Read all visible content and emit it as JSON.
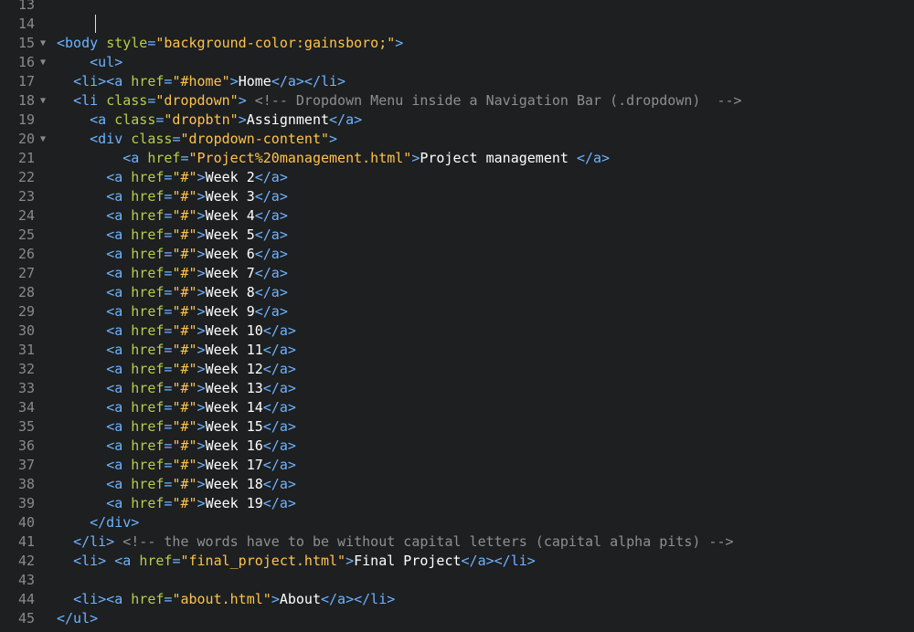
{
  "editor": {
    "lines": [
      {
        "num": "13",
        "fold": "",
        "indent": "",
        "tokens": []
      },
      {
        "num": "14",
        "fold": "",
        "indent": "",
        "tokens": []
      },
      {
        "num": "15",
        "fold": "▼",
        "indent": "",
        "tokens": [
          {
            "t": "tag",
            "v": "<body"
          },
          {
            "t": "txt",
            "v": " "
          },
          {
            "t": "attr",
            "v": "style"
          },
          {
            "t": "tag",
            "v": "="
          },
          {
            "t": "str",
            "v": "\"background-color:gainsboro;\""
          },
          {
            "t": "tag",
            "v": ">"
          }
        ]
      },
      {
        "num": "16",
        "fold": "▼",
        "indent": "    ",
        "tokens": [
          {
            "t": "tag",
            "v": "<ul>"
          }
        ]
      },
      {
        "num": "17",
        "fold": "",
        "indent": "  ",
        "tokens": [
          {
            "t": "tag",
            "v": "<li><a"
          },
          {
            "t": "txt",
            "v": " "
          },
          {
            "t": "attr",
            "v": "href"
          },
          {
            "t": "tag",
            "v": "="
          },
          {
            "t": "str",
            "v": "\"#home\""
          },
          {
            "t": "tag",
            "v": ">"
          },
          {
            "t": "txt",
            "v": "Home"
          },
          {
            "t": "tag",
            "v": "</a></li>"
          }
        ]
      },
      {
        "num": "18",
        "fold": "▼",
        "indent": "  ",
        "tokens": [
          {
            "t": "tag",
            "v": "<li"
          },
          {
            "t": "txt",
            "v": " "
          },
          {
            "t": "attr",
            "v": "class"
          },
          {
            "t": "tag",
            "v": "="
          },
          {
            "t": "str",
            "v": "\"dropdown\""
          },
          {
            "t": "tag",
            "v": ">"
          },
          {
            "t": "txt",
            "v": " "
          },
          {
            "t": "comment",
            "v": "<!-- Dropdown Menu inside a Navigation Bar (.dropdown)  -->"
          }
        ]
      },
      {
        "num": "19",
        "fold": "",
        "indent": "    ",
        "tokens": [
          {
            "t": "tag",
            "v": "<a"
          },
          {
            "t": "txt",
            "v": " "
          },
          {
            "t": "attr",
            "v": "class"
          },
          {
            "t": "tag",
            "v": "="
          },
          {
            "t": "str",
            "v": "\"dropbtn\""
          },
          {
            "t": "tag",
            "v": ">"
          },
          {
            "t": "txt",
            "v": "Assignment"
          },
          {
            "t": "tag",
            "v": "</a>"
          }
        ]
      },
      {
        "num": "20",
        "fold": "▼",
        "indent": "    ",
        "tokens": [
          {
            "t": "tag",
            "v": "<div"
          },
          {
            "t": "txt",
            "v": " "
          },
          {
            "t": "attr",
            "v": "class"
          },
          {
            "t": "tag",
            "v": "="
          },
          {
            "t": "str",
            "v": "\"dropdown-content\""
          },
          {
            "t": "tag",
            "v": ">"
          }
        ]
      },
      {
        "num": "21",
        "fold": "",
        "indent": "        ",
        "tokens": [
          {
            "t": "tag",
            "v": "<a"
          },
          {
            "t": "txt",
            "v": " "
          },
          {
            "t": "attr",
            "v": "href"
          },
          {
            "t": "tag",
            "v": "="
          },
          {
            "t": "str",
            "v": "\"Project%20management.html\""
          },
          {
            "t": "tag",
            "v": ">"
          },
          {
            "t": "txt",
            "v": "Project management "
          },
          {
            "t": "tag",
            "v": "</a>"
          }
        ]
      },
      {
        "num": "22",
        "fold": "",
        "indent": "      ",
        "tokens": [
          {
            "t": "tag",
            "v": "<a"
          },
          {
            "t": "txt",
            "v": " "
          },
          {
            "t": "attr",
            "v": "href"
          },
          {
            "t": "tag",
            "v": "="
          },
          {
            "t": "str",
            "v": "\"#\""
          },
          {
            "t": "tag",
            "v": ">"
          },
          {
            "t": "txt",
            "v": "Week 2"
          },
          {
            "t": "tag",
            "v": "</a>"
          }
        ]
      },
      {
        "num": "23",
        "fold": "",
        "indent": "      ",
        "tokens": [
          {
            "t": "tag",
            "v": "<a"
          },
          {
            "t": "txt",
            "v": " "
          },
          {
            "t": "attr",
            "v": "href"
          },
          {
            "t": "tag",
            "v": "="
          },
          {
            "t": "str",
            "v": "\"#\""
          },
          {
            "t": "tag",
            "v": ">"
          },
          {
            "t": "txt",
            "v": "Week 3"
          },
          {
            "t": "tag",
            "v": "</a>"
          }
        ]
      },
      {
        "num": "24",
        "fold": "",
        "indent": "      ",
        "tokens": [
          {
            "t": "tag",
            "v": "<a"
          },
          {
            "t": "txt",
            "v": " "
          },
          {
            "t": "attr",
            "v": "href"
          },
          {
            "t": "tag",
            "v": "="
          },
          {
            "t": "str",
            "v": "\"#\""
          },
          {
            "t": "tag",
            "v": ">"
          },
          {
            "t": "txt",
            "v": "Week 4"
          },
          {
            "t": "tag",
            "v": "</a>"
          }
        ]
      },
      {
        "num": "25",
        "fold": "",
        "indent": "      ",
        "tokens": [
          {
            "t": "tag",
            "v": "<a"
          },
          {
            "t": "txt",
            "v": " "
          },
          {
            "t": "attr",
            "v": "href"
          },
          {
            "t": "tag",
            "v": "="
          },
          {
            "t": "str",
            "v": "\"#\""
          },
          {
            "t": "tag",
            "v": ">"
          },
          {
            "t": "txt",
            "v": "Week 5"
          },
          {
            "t": "tag",
            "v": "</a>"
          }
        ]
      },
      {
        "num": "26",
        "fold": "",
        "indent": "      ",
        "tokens": [
          {
            "t": "tag",
            "v": "<a"
          },
          {
            "t": "txt",
            "v": " "
          },
          {
            "t": "attr",
            "v": "href"
          },
          {
            "t": "tag",
            "v": "="
          },
          {
            "t": "str",
            "v": "\"#\""
          },
          {
            "t": "tag",
            "v": ">"
          },
          {
            "t": "txt",
            "v": "Week 6"
          },
          {
            "t": "tag",
            "v": "</a>"
          }
        ]
      },
      {
        "num": "27",
        "fold": "",
        "indent": "      ",
        "tokens": [
          {
            "t": "tag",
            "v": "<a"
          },
          {
            "t": "txt",
            "v": " "
          },
          {
            "t": "attr",
            "v": "href"
          },
          {
            "t": "tag",
            "v": "="
          },
          {
            "t": "str",
            "v": "\"#\""
          },
          {
            "t": "tag",
            "v": ">"
          },
          {
            "t": "txt",
            "v": "Week 7"
          },
          {
            "t": "tag",
            "v": "</a>"
          }
        ]
      },
      {
        "num": "28",
        "fold": "",
        "indent": "      ",
        "tokens": [
          {
            "t": "tag",
            "v": "<a"
          },
          {
            "t": "txt",
            "v": " "
          },
          {
            "t": "attr",
            "v": "href"
          },
          {
            "t": "tag",
            "v": "="
          },
          {
            "t": "str",
            "v": "\"#\""
          },
          {
            "t": "tag",
            "v": ">"
          },
          {
            "t": "txt",
            "v": "Week 8"
          },
          {
            "t": "tag",
            "v": "</a>"
          }
        ]
      },
      {
        "num": "29",
        "fold": "",
        "indent": "      ",
        "tokens": [
          {
            "t": "tag",
            "v": "<a"
          },
          {
            "t": "txt",
            "v": " "
          },
          {
            "t": "attr",
            "v": "href"
          },
          {
            "t": "tag",
            "v": "="
          },
          {
            "t": "str",
            "v": "\"#\""
          },
          {
            "t": "tag",
            "v": ">"
          },
          {
            "t": "txt",
            "v": "Week 9"
          },
          {
            "t": "tag",
            "v": "</a>"
          }
        ]
      },
      {
        "num": "30",
        "fold": "",
        "indent": "      ",
        "tokens": [
          {
            "t": "tag",
            "v": "<a"
          },
          {
            "t": "txt",
            "v": " "
          },
          {
            "t": "attr",
            "v": "href"
          },
          {
            "t": "tag",
            "v": "="
          },
          {
            "t": "str",
            "v": "\"#\""
          },
          {
            "t": "tag",
            "v": ">"
          },
          {
            "t": "txt",
            "v": "Week 10"
          },
          {
            "t": "tag",
            "v": "</a>"
          }
        ]
      },
      {
        "num": "31",
        "fold": "",
        "indent": "      ",
        "tokens": [
          {
            "t": "tag",
            "v": "<a"
          },
          {
            "t": "txt",
            "v": " "
          },
          {
            "t": "attr",
            "v": "href"
          },
          {
            "t": "tag",
            "v": "="
          },
          {
            "t": "str",
            "v": "\"#\""
          },
          {
            "t": "tag",
            "v": ">"
          },
          {
            "t": "txt",
            "v": "Week 11"
          },
          {
            "t": "tag",
            "v": "</a>"
          }
        ]
      },
      {
        "num": "32",
        "fold": "",
        "indent": "      ",
        "tokens": [
          {
            "t": "tag",
            "v": "<a"
          },
          {
            "t": "txt",
            "v": " "
          },
          {
            "t": "attr",
            "v": "href"
          },
          {
            "t": "tag",
            "v": "="
          },
          {
            "t": "str",
            "v": "\"#\""
          },
          {
            "t": "tag",
            "v": ">"
          },
          {
            "t": "txt",
            "v": "Week 12"
          },
          {
            "t": "tag",
            "v": "</a>"
          }
        ]
      },
      {
        "num": "33",
        "fold": "",
        "indent": "      ",
        "tokens": [
          {
            "t": "tag",
            "v": "<a"
          },
          {
            "t": "txt",
            "v": " "
          },
          {
            "t": "attr",
            "v": "href"
          },
          {
            "t": "tag",
            "v": "="
          },
          {
            "t": "str",
            "v": "\"#\""
          },
          {
            "t": "tag",
            "v": ">"
          },
          {
            "t": "txt",
            "v": "Week 13"
          },
          {
            "t": "tag",
            "v": "</a>"
          }
        ]
      },
      {
        "num": "34",
        "fold": "",
        "indent": "      ",
        "tokens": [
          {
            "t": "tag",
            "v": "<a"
          },
          {
            "t": "txt",
            "v": " "
          },
          {
            "t": "attr",
            "v": "href"
          },
          {
            "t": "tag",
            "v": "="
          },
          {
            "t": "str",
            "v": "\"#\""
          },
          {
            "t": "tag",
            "v": ">"
          },
          {
            "t": "txt",
            "v": "Week 14"
          },
          {
            "t": "tag",
            "v": "</a>"
          }
        ]
      },
      {
        "num": "35",
        "fold": "",
        "indent": "      ",
        "tokens": [
          {
            "t": "tag",
            "v": "<a"
          },
          {
            "t": "txt",
            "v": " "
          },
          {
            "t": "attr",
            "v": "href"
          },
          {
            "t": "tag",
            "v": "="
          },
          {
            "t": "str",
            "v": "\"#\""
          },
          {
            "t": "tag",
            "v": ">"
          },
          {
            "t": "txt",
            "v": "Week 15"
          },
          {
            "t": "tag",
            "v": "</a>"
          }
        ]
      },
      {
        "num": "36",
        "fold": "",
        "indent": "      ",
        "tokens": [
          {
            "t": "tag",
            "v": "<a"
          },
          {
            "t": "txt",
            "v": " "
          },
          {
            "t": "attr",
            "v": "href"
          },
          {
            "t": "tag",
            "v": "="
          },
          {
            "t": "str",
            "v": "\"#\""
          },
          {
            "t": "tag",
            "v": ">"
          },
          {
            "t": "txt",
            "v": "Week 16"
          },
          {
            "t": "tag",
            "v": "</a>"
          }
        ]
      },
      {
        "num": "37",
        "fold": "",
        "indent": "      ",
        "tokens": [
          {
            "t": "tag",
            "v": "<a"
          },
          {
            "t": "txt",
            "v": " "
          },
          {
            "t": "attr",
            "v": "href"
          },
          {
            "t": "tag",
            "v": "="
          },
          {
            "t": "str",
            "v": "\"#\""
          },
          {
            "t": "tag",
            "v": ">"
          },
          {
            "t": "txt",
            "v": "Week 17"
          },
          {
            "t": "tag",
            "v": "</a>"
          }
        ]
      },
      {
        "num": "38",
        "fold": "",
        "indent": "      ",
        "tokens": [
          {
            "t": "tag",
            "v": "<a"
          },
          {
            "t": "txt",
            "v": " "
          },
          {
            "t": "attr",
            "v": "href"
          },
          {
            "t": "tag",
            "v": "="
          },
          {
            "t": "str",
            "v": "\"#\""
          },
          {
            "t": "tag",
            "v": ">"
          },
          {
            "t": "txt",
            "v": "Week 18"
          },
          {
            "t": "tag",
            "v": "</a>"
          }
        ]
      },
      {
        "num": "39",
        "fold": "",
        "indent": "      ",
        "tokens": [
          {
            "t": "tag",
            "v": "<a"
          },
          {
            "t": "txt",
            "v": " "
          },
          {
            "t": "attr",
            "v": "href"
          },
          {
            "t": "tag",
            "v": "="
          },
          {
            "t": "str",
            "v": "\"#\""
          },
          {
            "t": "tag",
            "v": ">"
          },
          {
            "t": "txt",
            "v": "Week 19"
          },
          {
            "t": "tag",
            "v": "</a>"
          }
        ]
      },
      {
        "num": "40",
        "fold": "",
        "indent": "    ",
        "tokens": [
          {
            "t": "tag",
            "v": "</div>"
          }
        ]
      },
      {
        "num": "41",
        "fold": "",
        "indent": "  ",
        "tokens": [
          {
            "t": "tag",
            "v": "</li>"
          },
          {
            "t": "txt",
            "v": " "
          },
          {
            "t": "comment",
            "v": "<!-- the words have to be without capital letters (capital alpha pits) -->"
          }
        ]
      },
      {
        "num": "42",
        "fold": "",
        "indent": "  ",
        "tokens": [
          {
            "t": "tag",
            "v": "<li>"
          },
          {
            "t": "txt",
            "v": " "
          },
          {
            "t": "tag",
            "v": "<a"
          },
          {
            "t": "txt",
            "v": " "
          },
          {
            "t": "attr",
            "v": "href"
          },
          {
            "t": "tag",
            "v": "="
          },
          {
            "t": "str",
            "v": "\"final_project.html\""
          },
          {
            "t": "tag",
            "v": ">"
          },
          {
            "t": "txt",
            "v": "Final Project"
          },
          {
            "t": "tag",
            "v": "</a></li>"
          }
        ]
      },
      {
        "num": "43",
        "fold": "",
        "indent": "",
        "tokens": []
      },
      {
        "num": "44",
        "fold": "",
        "indent": "  ",
        "tokens": [
          {
            "t": "tag",
            "v": "<li><a"
          },
          {
            "t": "txt",
            "v": " "
          },
          {
            "t": "attr",
            "v": "href"
          },
          {
            "t": "tag",
            "v": "="
          },
          {
            "t": "str",
            "v": "\"about.html\""
          },
          {
            "t": "tag",
            "v": ">"
          },
          {
            "t": "txt",
            "v": "About"
          },
          {
            "t": "tag",
            "v": "</a></li>"
          }
        ]
      },
      {
        "num": "45",
        "fold": "",
        "indent": "",
        "tokens": [
          {
            "t": "tag",
            "v": "</ul>"
          }
        ]
      }
    ]
  }
}
